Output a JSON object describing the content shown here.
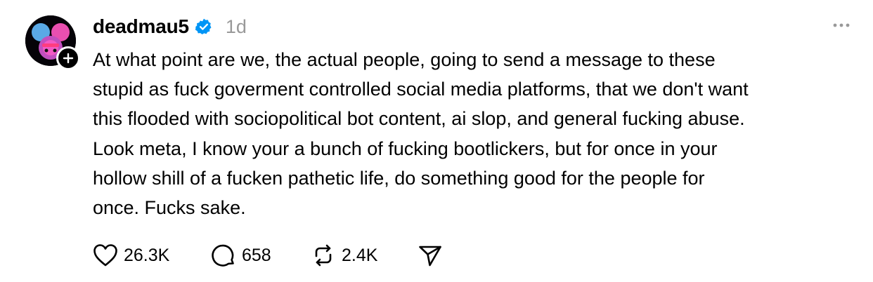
{
  "post": {
    "username": "deadmau5",
    "timestamp": "1d",
    "verified": true,
    "body_lines": [
      "At what point are we, the actual people, going to send a message to these",
      "stupid as fuck goverment controlled social media platforms, that we don't want",
      "this flooded with sociopolitical bot content, ai slop, and general fucking abuse.",
      "Look meta, I know your a bunch of fucking bootlickers, but for once in your",
      "hollow shill of a fucken pathetic life, do something good for the people for",
      "once. Fucks sake."
    ],
    "actions": {
      "likes": "26.3K",
      "replies": "658",
      "reposts": "2.4K"
    }
  },
  "icons": {
    "avatar": "deadmau5-helmet-avatar",
    "follow": "plus-icon",
    "verified": "verified-badge-icon",
    "more": "more-dots-icon",
    "like": "heart-icon",
    "reply": "comment-bubble-icon",
    "repost": "repost-icon",
    "share": "send-icon"
  },
  "colors": {
    "verified_blue": "#0095f6",
    "muted_gray": "#999999",
    "text": "#000000"
  }
}
